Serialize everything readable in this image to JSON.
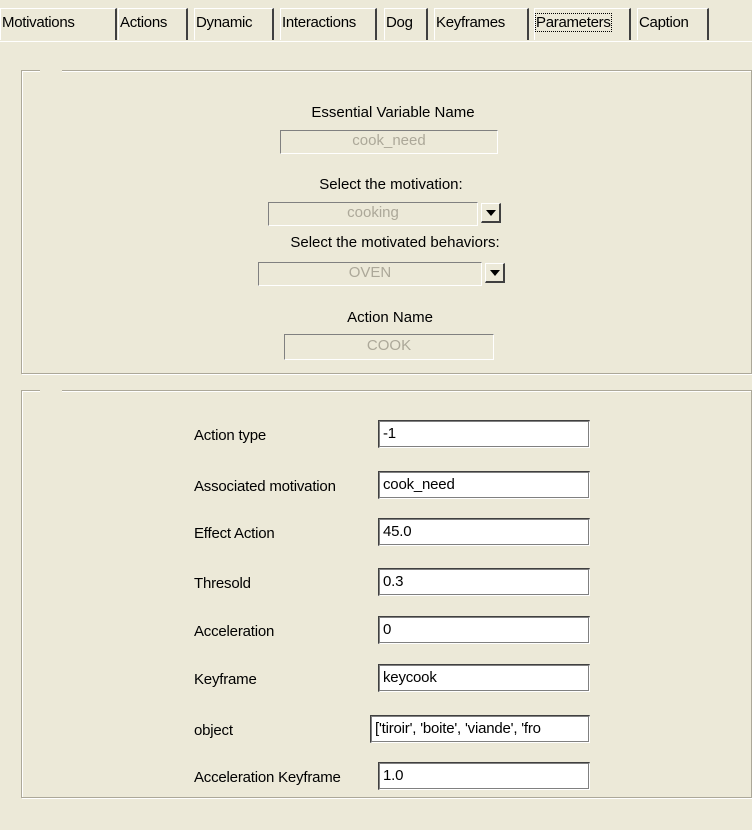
{
  "tabs": [
    {
      "label": "Motivations",
      "active": false
    },
    {
      "label": "Actions",
      "active": false
    },
    {
      "label": "Dynamic",
      "active": false
    },
    {
      "label": "Interactions",
      "active": false
    },
    {
      "label": "Dog",
      "active": false
    },
    {
      "label": "Keyframes",
      "active": false
    },
    {
      "label": "Parameters",
      "active": true
    },
    {
      "label": "Caption",
      "active": false
    }
  ],
  "selection": {
    "essential_variable_label": "Essential Variable Name",
    "essential_variable_value": "cook_need",
    "motivation_label": "Select the motivation:",
    "motivation_value": "cooking",
    "behaviors_label": "Select the motivated behaviors:",
    "behaviors_value": "OVEN",
    "action_name_label": "Action Name",
    "action_name_value": "COOK"
  },
  "parameters": [
    {
      "label": "Action type",
      "value": "-1"
    },
    {
      "label": "Associated motivation",
      "value": "cook_need"
    },
    {
      "label": "Effect Action",
      "value": "45.0"
    },
    {
      "label": "Thresold",
      "value": "0.3"
    },
    {
      "label": "Acceleration",
      "value": "0"
    },
    {
      "label": "Keyframe",
      "value": "keycook"
    },
    {
      "label": "object",
      "value": "['tiroir', 'boite', 'viande', 'fro"
    },
    {
      "label": "Acceleration Keyframe",
      "value": "1.0"
    }
  ],
  "colors": {
    "window_bg": "#ece9d8",
    "disabled_text": "#aca899",
    "field_bg": "#ffffff"
  }
}
